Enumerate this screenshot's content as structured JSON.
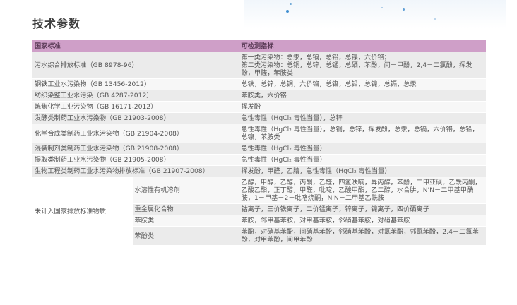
{
  "page": {
    "title": "技术参数"
  },
  "table": {
    "headers": [
      "国家标准",
      "可检测指标"
    ],
    "rows": [
      {
        "standard": "污水综合排放标准（GB 8978-96）",
        "indicators": "第一类污染物：总汞，总镉，总铅，总镍，六价铬；\n第二类污染物：总铜，总锌，总锰，总硒，苯酚，间－甲酚，2,4－二氯酚，挥发酚，甲醛，苯胺类"
      },
      {
        "standard": "钢铁工业水污染物（GB 13456-2012）",
        "indicators": "总铁，总锌，总铜，六价铬，总铬，总铅，总镍，总镉，总汞"
      },
      {
        "standard": "纺织染整工业水污染（GB 4287-2012）",
        "indicators": "苯胺类，六价铬"
      },
      {
        "standard": "炼焦化学工业污染物（GB 16171-2012）",
        "indicators": "挥发酚"
      },
      {
        "standard": "发酵类制药工业水污染物（GB 21903-2008）",
        "indicators": "急性毒性（HgCl₂ 毒性当量），总锌"
      },
      {
        "standard": "化学合成类制药工业水污染物（GB 21904-2008）",
        "indicators": "急性毒性（HgCl₂ 毒性当量），总铜，总锌，挥发酚，总汞，总镉，六价铬，总铅，总镍，苯胺类"
      },
      {
        "standard": "混装制剂类制药工业水污染物（GB 21908-2008）",
        "indicators": "急性毒性（HgCl₂ 毒性当量）"
      },
      {
        "standard": "提取类制药工业水污染物（GB 21905-2008）",
        "indicators": "急性毒性（HgCl₂ 毒性当量）"
      },
      {
        "standard": "生物工程类制药工业水污染物排放标准（GB 21907-2008）",
        "indicators": "挥发酚，甲醛，乙腈，急性毒性（HgCl₂ 毒性当量）"
      }
    ],
    "group": {
      "label": "未计入国家排放标准物质",
      "items": [
        {
          "category": "水溶性有机溶剂",
          "indicators": "乙醇，甲醇，乙醇，丙酮，乙醛，四氢呋喃，异丙醇，苯酚，二甲亚砜，乙酰丙酮，乙酸乙酯，正丁醇，甲醛，吡啶，乙酸甲酯，乙二醇，水合肼，N'N－二甲基甲酰胺，1－甲基－2－吡咯烷酮，N'N－二甲基乙酰胺"
        },
        {
          "category": "重金属化合物",
          "indicators": "钴离子，三价铁离子，二价锰离子，锌离子，镍离子，四价硒离子"
        },
        {
          "category": "苯胺类",
          "indicators": "苯胺，邻甲基苯胺，对甲基苯胺，邻硝基苯胺，对硝基苯胺"
        },
        {
          "category": "苯酚类",
          "indicators": "苯酚，对硝基苯酚，间硝基苯酚，邻硝基苯酚，对氯苯酚，邻氯苯酚，2,4－二氯苯酚，对甲苯酚，间甲苯酚"
        }
      ]
    }
  }
}
